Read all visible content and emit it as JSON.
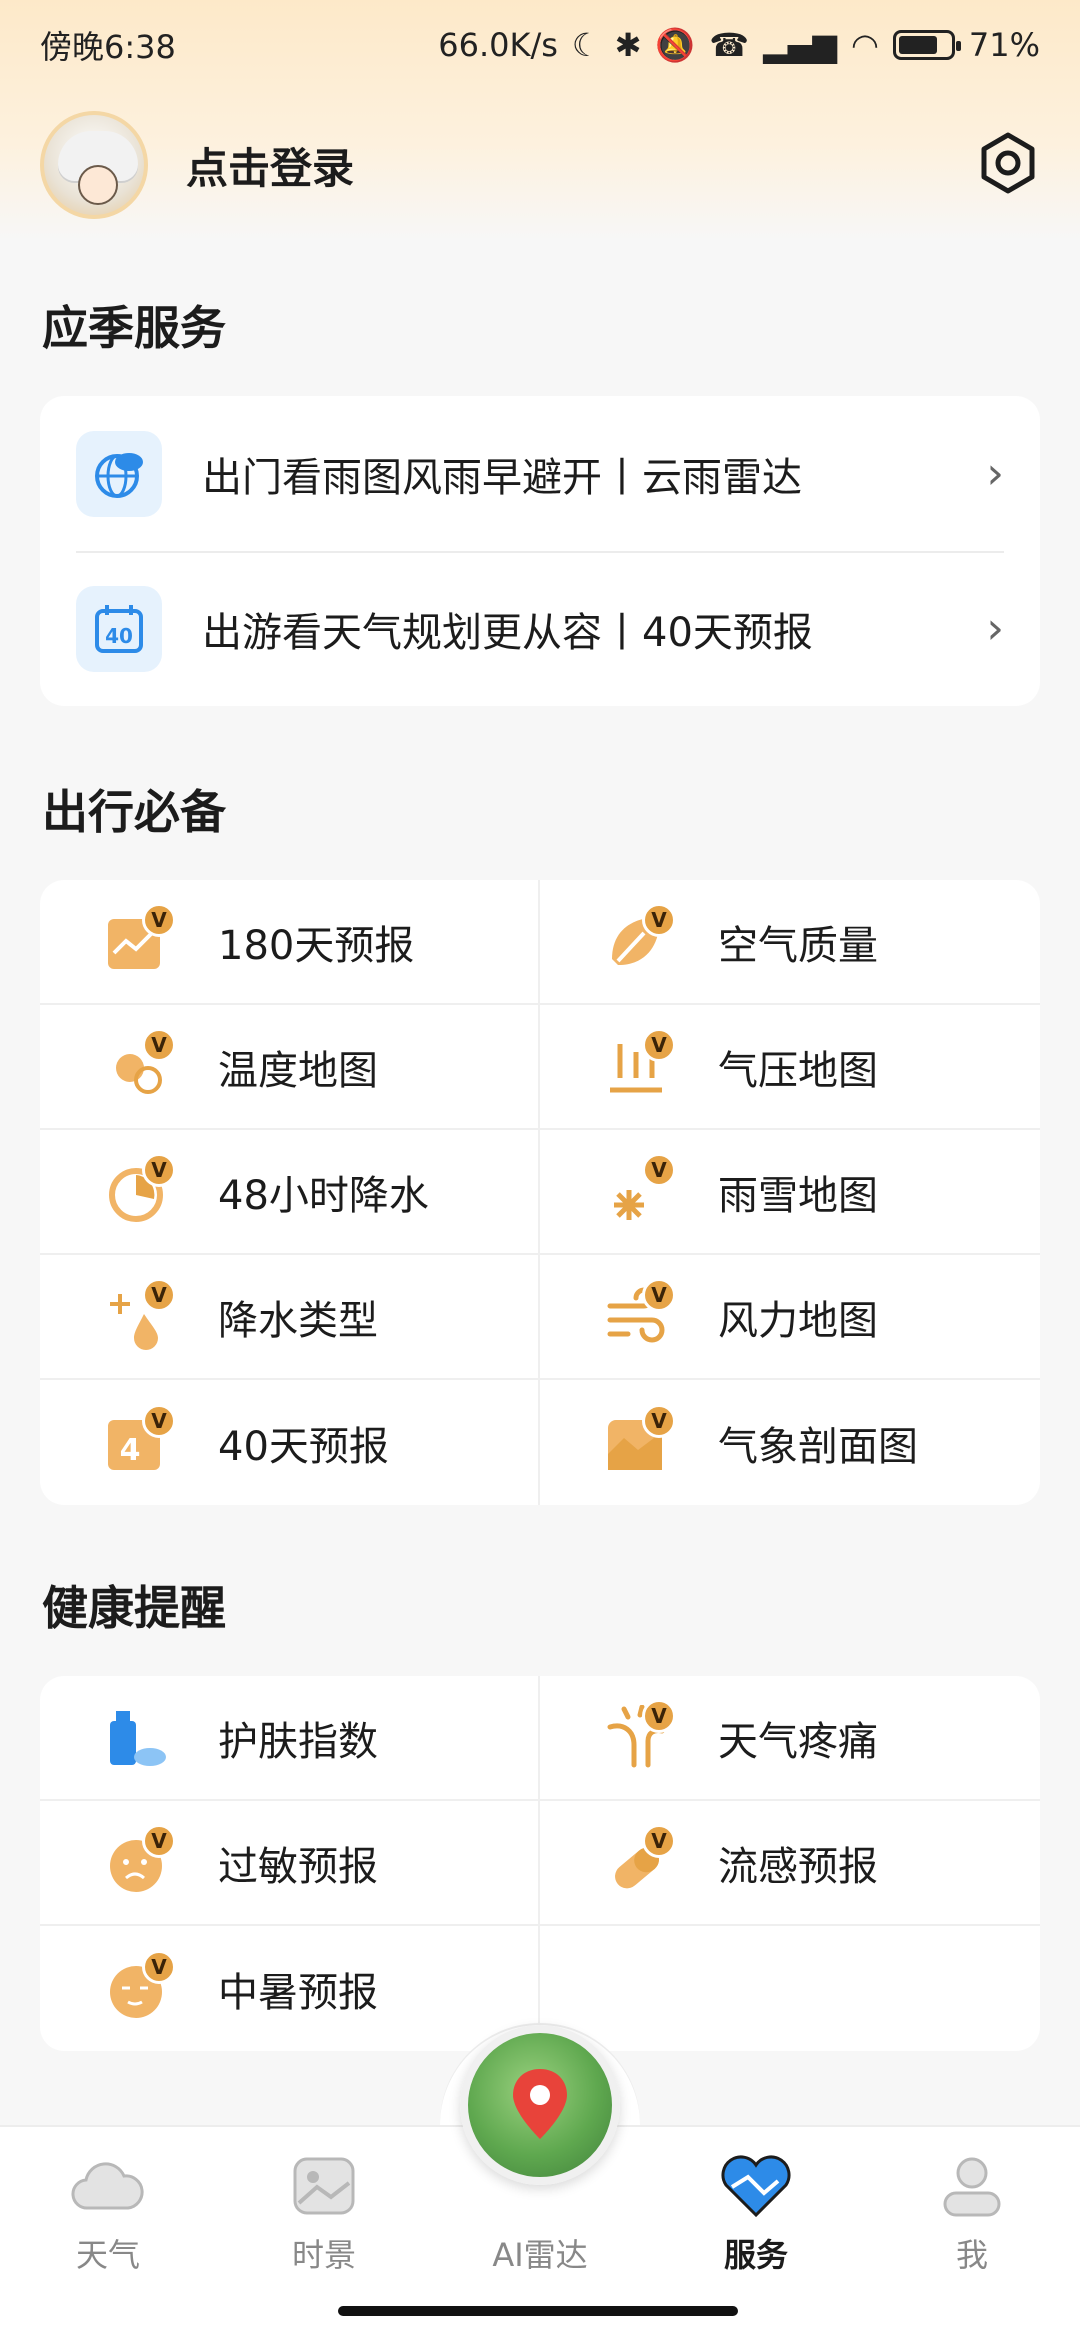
{
  "status_bar": {
    "time": "傍晚6:38",
    "network_speed": "66.0K/s",
    "battery": "71%"
  },
  "header": {
    "login_label": "点击登录"
  },
  "seasonal": {
    "title": "应季服务",
    "items": [
      {
        "label": "出门看雨图风雨早避开丨云雨雷达",
        "icon": "cloud-rain-globe-icon"
      },
      {
        "label": "出游看天气规划更从容丨40天预报",
        "icon": "calendar-40-icon"
      }
    ]
  },
  "travel": {
    "title": "出行必备",
    "items": [
      {
        "label": "180天预报",
        "icon": "chart-180-icon"
      },
      {
        "label": "空气质量",
        "icon": "leaf-icon"
      },
      {
        "label": "温度地图",
        "icon": "sun-thermometer-icon"
      },
      {
        "label": "气压地图",
        "icon": "pressure-arrows-icon"
      },
      {
        "label": "48小时降水",
        "icon": "rain-48-icon"
      },
      {
        "label": "雨雪地图",
        "icon": "snow-rain-icon"
      },
      {
        "label": "降水类型",
        "icon": "precip-type-icon"
      },
      {
        "label": "风力地图",
        "icon": "wind-icon"
      },
      {
        "label": "40天预报",
        "icon": "forecast-40-icon"
      },
      {
        "label": "气象剖面图",
        "icon": "profile-chart-icon"
      }
    ]
  },
  "health": {
    "title": "健康提醒",
    "items": [
      {
        "label": "护肤指数",
        "icon": "skincare-icon"
      },
      {
        "label": "天气疼痛",
        "icon": "joint-pain-icon"
      },
      {
        "label": "过敏预报",
        "icon": "allergy-face-icon"
      },
      {
        "label": "流感预报",
        "icon": "flu-pill-icon"
      },
      {
        "label": "中暑预报",
        "icon": "heatstroke-face-icon"
      }
    ]
  },
  "nav": {
    "items": [
      {
        "label": "天气",
        "icon": "cloud-icon"
      },
      {
        "label": "时景",
        "icon": "image-icon"
      },
      {
        "label": "AI雷达",
        "icon": "radar-location-icon"
      },
      {
        "label": "服务",
        "icon": "heart-service-icon"
      },
      {
        "label": "我",
        "icon": "person-icon"
      }
    ],
    "active": "服务"
  },
  "colors": {
    "accent": "#e6a346",
    "blue": "#2d8be8"
  }
}
